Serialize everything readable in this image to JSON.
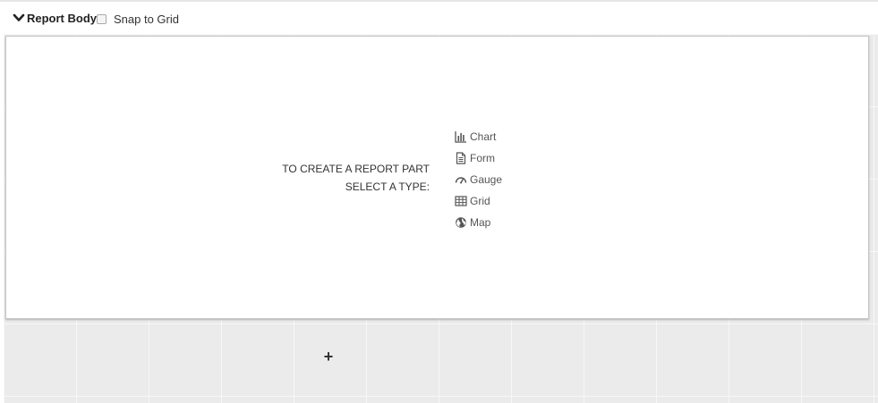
{
  "header": {
    "section_title": "Report Body",
    "snap_label": "Snap to Grid",
    "snap_checked": false
  },
  "panel": {
    "instruction_line1": "TO CREATE A REPORT PART",
    "instruction_line2": "SELECT A TYPE:",
    "types": [
      {
        "label": "Chart",
        "icon": "bar-chart-icon"
      },
      {
        "label": "Form",
        "icon": "document-icon"
      },
      {
        "label": "Gauge",
        "icon": "gauge-icon"
      },
      {
        "label": "Grid",
        "icon": "table-icon"
      },
      {
        "label": "Map",
        "icon": "globe-icon"
      }
    ]
  },
  "canvas": {
    "add_symbol": "+"
  },
  "colors": {
    "canvas_bg": "#ebebeb",
    "grid_line": "#f7f7f7",
    "panel_bg": "#ffffff",
    "text": "#333333"
  }
}
